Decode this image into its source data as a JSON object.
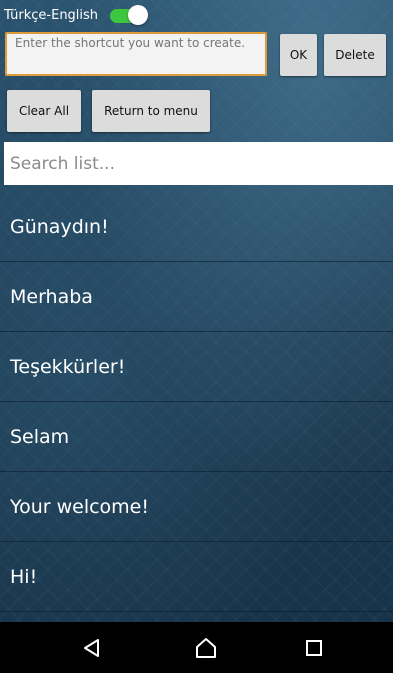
{
  "header": {
    "toggle_label": "Türkçe-English",
    "toggle_on": true,
    "toggle_color": "#3ec63e"
  },
  "shortcut": {
    "placeholder": "Enter the shortcut you want to create.",
    "accent": "#e09b39"
  },
  "buttons": {
    "ok": "OK",
    "delete": "Delete",
    "clear_all": "Clear All",
    "return_menu": "Return to menu"
  },
  "search": {
    "placeholder": "Search list..."
  },
  "list": {
    "items": [
      "Günaydın!",
      "Merhaba",
      "Teşekkürler!",
      "Selam",
      "Your welcome!",
      "Hi!"
    ]
  },
  "navbar": {
    "back_icon": "back-triangle-icon",
    "home_icon": "home-circle-icon",
    "recent_icon": "recent-apps-square-icon"
  }
}
